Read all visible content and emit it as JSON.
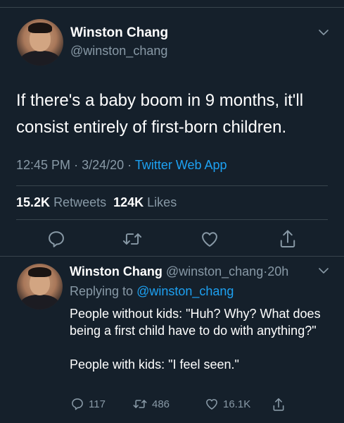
{
  "tweet": {
    "author_name": "Winston Chang",
    "author_handle": "@winston_chang",
    "text": "If there's a baby boom in 9 months, it'll consist entirely of first-born children.",
    "time": "12:45 PM",
    "separator": "·",
    "date": "3/24/20",
    "source": "Twitter Web App",
    "retweets_count": "15.2K",
    "retweets_label": "Retweets",
    "likes_count": "124K",
    "likes_label": "Likes"
  },
  "reply": {
    "author_name": "Winston Chang",
    "author_handle": "@winston_chang",
    "age": "20h",
    "replying_prefix": "Replying to",
    "replying_to": "@winston_chang",
    "paragraphs": [
      "People without kids: \"Huh? Why? What does being a first child have to do with anything?\"",
      "People with kids: \"I feel seen.\""
    ],
    "reply_count": "117",
    "retweet_count": "486",
    "like_count": "16.1K"
  },
  "icons": {
    "chevron": "chevron-down-icon",
    "reply": "reply-icon",
    "retweet": "retweet-icon",
    "like": "heart-icon",
    "share": "share-icon"
  },
  "colors": {
    "background": "#15202b",
    "primary_text": "#ffffff",
    "secondary_text": "#8899a6",
    "accent": "#1da1f2",
    "divider": "#38444d"
  }
}
